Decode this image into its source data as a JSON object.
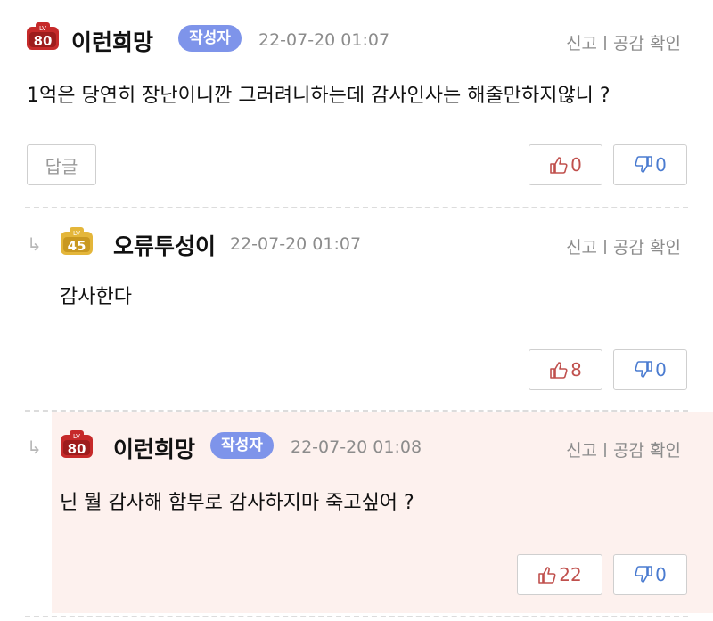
{
  "comments": [
    {
      "level": "80",
      "level_label": "LV",
      "nickname": "이런희망",
      "author_tag": "작성자",
      "timestamp": "22-07-20 01:07",
      "report": "신고",
      "empathy": "공감 확인",
      "text": "1억은 당연히 장난이니깐 그러려니하는데 감사인사는 해줄만하지않니 ?",
      "reply_button": "답글",
      "likes": "0",
      "dislikes": "0",
      "badge_color": "#c62a2a"
    },
    {
      "level": "45",
      "level_label": "LV",
      "nickname": "오류투성이",
      "timestamp": "22-07-20 01:07",
      "report": "신고",
      "empathy": "공감 확인",
      "text": "감사한다",
      "likes": "8",
      "dislikes": "0",
      "badge_color": "#e4b63a"
    },
    {
      "level": "80",
      "level_label": "LV",
      "nickname": "이런희망",
      "author_tag": "작성자",
      "timestamp": "22-07-20 01:08",
      "report": "신고",
      "empathy": "공감 확인",
      "text": "닌 뭘 감사해 함부로 감사하지마 죽고싶어 ?",
      "likes": "22",
      "dislikes": "0",
      "badge_color": "#c62a2a"
    }
  ],
  "icons": {
    "reply_arrow": "reply-arrow-icon",
    "thumbs_up": "thumbs-up-icon",
    "thumbs_down": "thumbs-down-icon",
    "level_badge": "level-badge-icon"
  },
  "colors": {
    "author_tag": "#7e94ea",
    "like": "#c0504d",
    "dislike": "#4a7bd0",
    "highlight_bg": "#fdf1ee"
  }
}
